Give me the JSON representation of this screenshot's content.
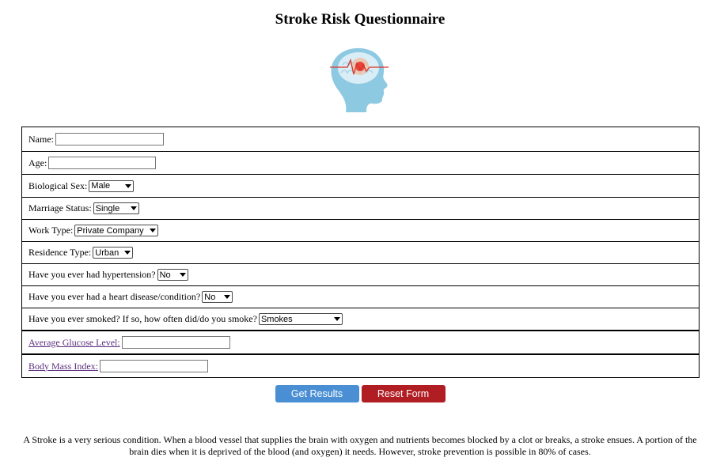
{
  "page": {
    "title": "Stroke Risk Questionnaire"
  },
  "form": {
    "name_label": "Name:",
    "age_label": "Age:",
    "sex_label": "Biological Sex:",
    "sex_value": "Male",
    "marriage_label": "Marriage Status:",
    "marriage_value": "Single",
    "work_label": "Work Type:",
    "work_value": "Private Company",
    "residence_label": "Residence Type:",
    "residence_value": "Urban",
    "hypertension_label": "Have you ever had hypertension?",
    "hypertension_value": "No",
    "heart_label": "Have you ever had a heart disease/condition?",
    "heart_value": "No",
    "smoke_label": "Have you ever smoked? If so, how often did/do you smoke?",
    "smoke_value": "Smokes",
    "glucose_label": "Average Glucose Level:",
    "bmi_label": "Body Mass Index:"
  },
  "buttons": {
    "submit_label": "Get Results",
    "reset_label": "Reset Form"
  },
  "info": {
    "text": "A Stroke is a very serious condition. When a blood vessel that supplies the brain with oxygen and nutrients becomes blocked by a clot or breaks, a stroke ensues. A portion of the brain dies when it is deprived of the blood (and oxygen) it needs. However, stroke prevention is possible in 80% of cases."
  },
  "icons": {
    "logo": "brain-head-icon"
  },
  "colors": {
    "submit": "#4a8fd4",
    "reset": "#b01e24",
    "link": "#5a2d7e"
  }
}
